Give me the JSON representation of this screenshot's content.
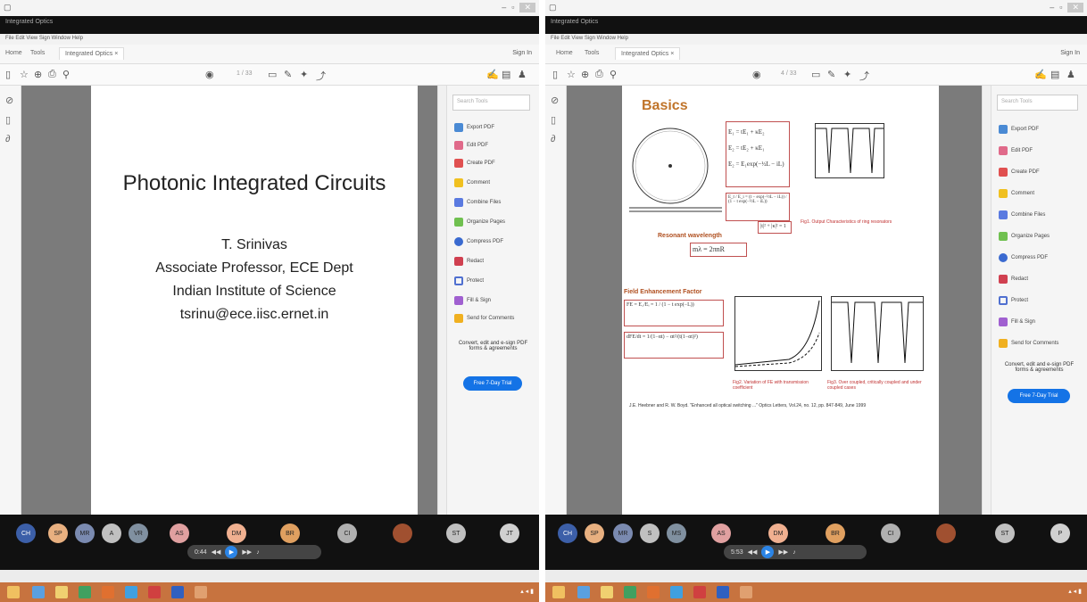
{
  "left_window": {
    "title": "Integrated Optics",
    "menu": "File  Edit  View  Sign  Window  Help",
    "tabs": {
      "home": "Home",
      "tools": "Tools",
      "active": "Integrated Optics ×"
    },
    "signin": "Sign In",
    "page_counter": "1 / 33",
    "slide": {
      "title": "Photonic Integrated Circuits",
      "author": "T. Srinivas",
      "role": "Associate Professor, ECE Dept",
      "institute": "Indian Institute of Science",
      "email": "tsrinu@ece.iisc.ernet.in"
    },
    "search_placeholder": "Search Tools",
    "tools": [
      "Export PDF",
      "Edit PDF",
      "Create PDF",
      "Comment",
      "Combine Files",
      "Organize Pages",
      "Compress PDF",
      "Redact",
      "Protect",
      "Fill & Sign",
      "Send for Comments"
    ],
    "note": "Convert, edit and e-sign PDF forms & agreements",
    "trial_button": "Free 7-Day Trial",
    "participants": [
      "CH",
      "SP",
      "MR",
      "A",
      "VR",
      "AS",
      "DM",
      "BR",
      "CI",
      "",
      "ST",
      "JT"
    ],
    "time": "0:44"
  },
  "right_window": {
    "title": "Integrated Optics",
    "menu": "File  Edit  View  Sign  Window  Help",
    "tabs": {
      "home": "Home",
      "tools": "Tools",
      "active": "Integrated Optics ×"
    },
    "signin": "Sign In",
    "page_counter": "4 / 33",
    "slide": {
      "heading": "Basics",
      "eq1": "E₁ = tE₁ + κE₂",
      "eq2": "E₂ = tE₂ + κE₁",
      "eq3": "E₂ = E₁exp(−½L − iL)",
      "eq4": "E_t / E_i = (t − exp(−½L − iL)) / (1 − t exp(−½L − iL))",
      "resonant_label": "Resonant wavelength",
      "resonant_eq": "mλ = 2πnR",
      "unity": "|t|² + |κ|² = 1",
      "cap1": "Fig1. Output Characteristics of ring resonators",
      "field_label": "Field Enhancement Factor",
      "fe_eq1": "FE = E₁/Eᵢ = 1 / (1 − t exp(−L))",
      "fe_eq2": "dFE/dt = 1/(1−αt) − αt²/(t(1−αt)²)",
      "cap2": "Fig2. Variation of FE with transmission coefficient",
      "cap3": "Fig3. Over coupled, critically coupled and under coupled cases",
      "reference": "J.E. Heebner and R. W. Boyd. \"Enhanced all optical switching ...\" Optics Letters, Vol.24, no. 12, pp. 847-849, June 1999"
    },
    "search_placeholder": "Search Tools",
    "tools": [
      "Export PDF",
      "Edit PDF",
      "Create PDF",
      "Comment",
      "Combine Files",
      "Organize Pages",
      "Compress PDF",
      "Redact",
      "Protect",
      "Fill & Sign",
      "Send for Comments"
    ],
    "note": "Convert, edit and e-sign PDF forms & agreements",
    "trial_button": "Free 7-Day Trial",
    "participants": [
      "CH",
      "SP",
      "MR",
      "S",
      "MS",
      "AS",
      "DM",
      "BR",
      "CI",
      "",
      "ST",
      "P"
    ],
    "time": "5:53"
  }
}
